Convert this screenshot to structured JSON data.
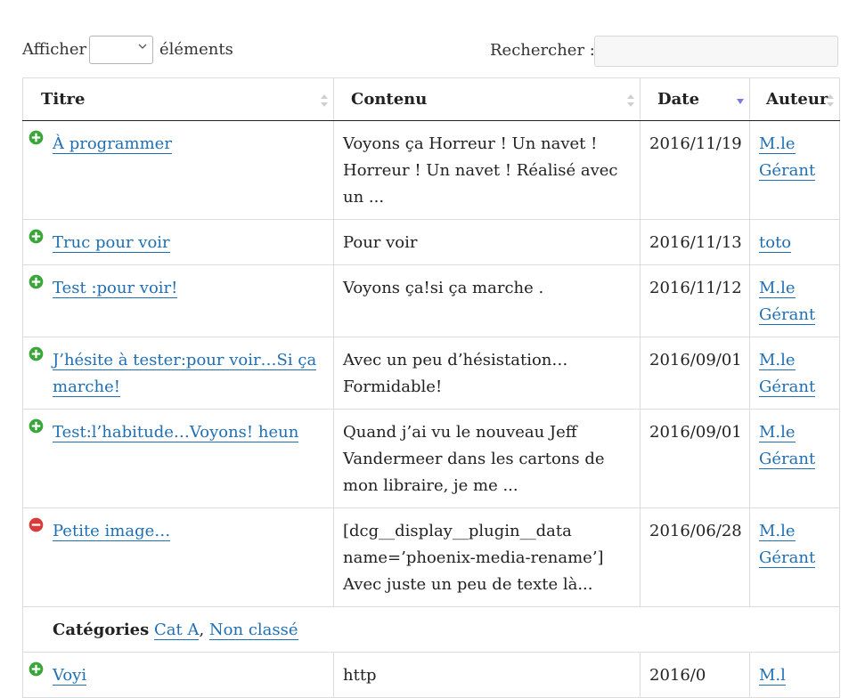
{
  "controls": {
    "show_label": "Afficher",
    "entries_label": "éléments",
    "search_label": "Rechercher :",
    "page_length_value": "",
    "search_value": ""
  },
  "table": {
    "headers": [
      "Titre",
      "Contenu",
      "Date",
      "Auteur"
    ],
    "rows": [
      {
        "title": "À programmer",
        "content": "Voyons ça Horreur ! Un navet ! Horreur ! Un navet ! Réalisé avec un ...",
        "date": "2016/11/19",
        "author": "M.le Gérant",
        "expanded": false
      },
      {
        "title": "Truc pour voir",
        "content": "Pour voir",
        "date": "2016/11/13",
        "author": "toto",
        "expanded": false
      },
      {
        "title": "Test :pour voir!",
        "content": "Voyons ça!si ça marche .",
        "date": "2016/11/12",
        "author": "M.le Gérant",
        "expanded": false
      },
      {
        "title": "J’hésite à tester:pour voir…Si ça marche!",
        "content": "Avec un peu d’hésistation…Formidable!",
        "date": "2016/09/01",
        "author": "M.le Gérant",
        "expanded": false
      },
      {
        "title": "Test:l’habitude…Voyons! heun",
        "content": "Quand j’ai vu le nouveau Jeff Vandermeer dans les cartons de mon libraire, je me ...",
        "date": "2016/09/01",
        "author": "M.le Gérant",
        "expanded": false
      },
      {
        "title": "Petite image…",
        "content": "[dcg__display__plugin__data name=’phoenix-media-rename’] Avec juste un peu de texte là...",
        "date": "2016/06/28",
        "author": "M.le Gérant",
        "expanded": true
      }
    ],
    "child": {
      "label": "Catégories",
      "categories": [
        "Cat A",
        "Non classé"
      ],
      "separator": ", "
    },
    "partial_row": {
      "title": "Voyi",
      "content": "http",
      "date": "2016/0",
      "author": "M.l"
    }
  },
  "colors": {
    "link": "#1f6fb5",
    "expand": "#3aa63a",
    "collapse": "#d93a3a",
    "sort_active": "#7a7adf"
  },
  "icons": {
    "expand": "plus-circle-icon",
    "collapse": "minus-circle-icon",
    "sort": "sort-arrows-icon",
    "dropdown": "chevron-down-icon"
  }
}
